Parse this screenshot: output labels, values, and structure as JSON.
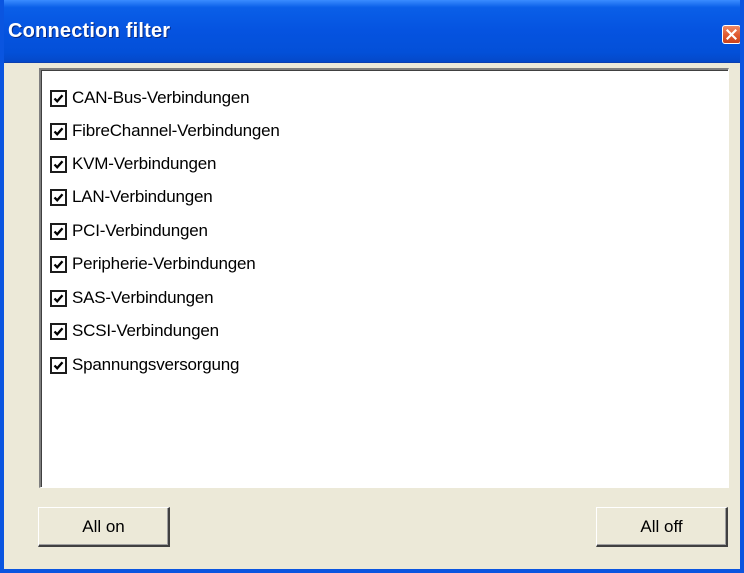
{
  "window": {
    "title": "Connection filter"
  },
  "filter_list": {
    "items": [
      {
        "label": "CAN-Bus-Verbindungen",
        "checked": true
      },
      {
        "label": "FibreChannel-Verbindungen",
        "checked": true
      },
      {
        "label": "KVM-Verbindungen",
        "checked": true
      },
      {
        "label": "LAN-Verbindungen",
        "checked": true
      },
      {
        "label": "PCI-Verbindungen",
        "checked": true
      },
      {
        "label": "Peripherie-Verbindungen",
        "checked": true
      },
      {
        "label": "SAS-Verbindungen",
        "checked": true
      },
      {
        "label": "SCSI-Verbindungen",
        "checked": true
      },
      {
        "label": "Spannungsversorgung",
        "checked": true
      }
    ]
  },
  "buttons": {
    "all_on": "All on",
    "all_off": "All off"
  },
  "colors": {
    "titlebar": "#0553e0",
    "dialog_background": "#ece9d8",
    "close_button": "#e0582e"
  },
  "icons": {
    "close": "close-icon",
    "check": "checkmark-icon"
  }
}
